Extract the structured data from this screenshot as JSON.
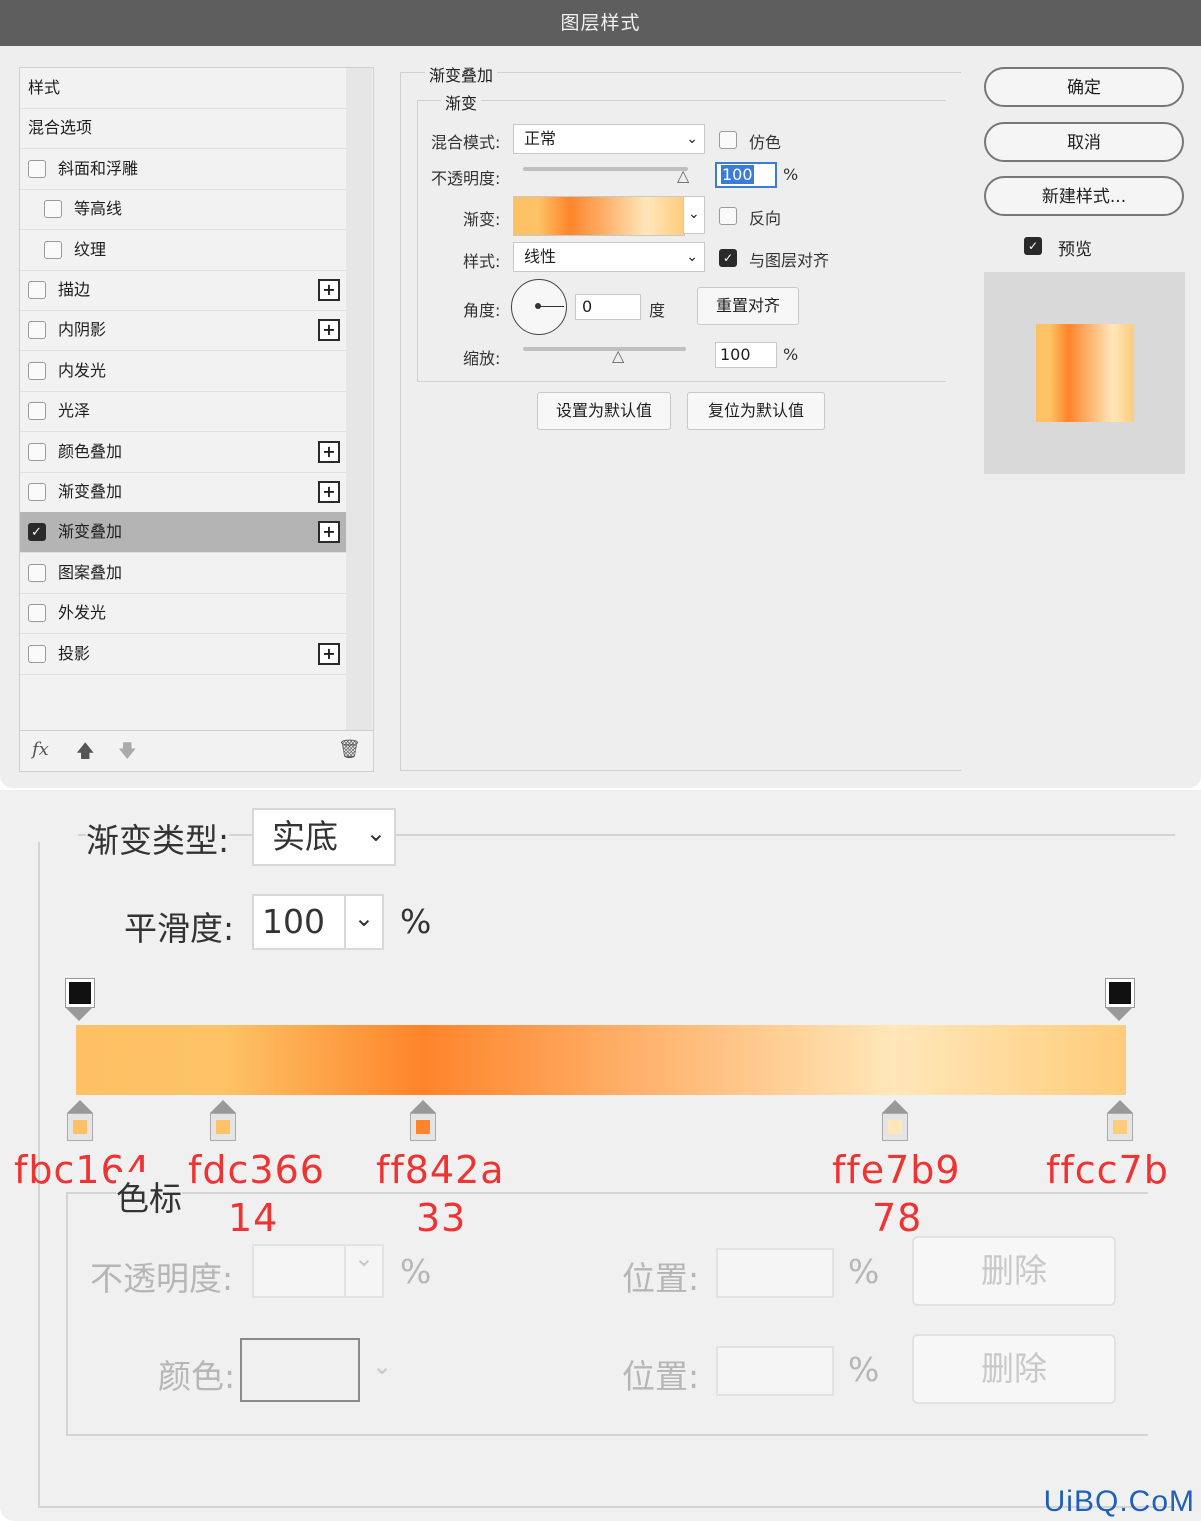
{
  "dialog": {
    "title": "图层样式",
    "list_header": "样式",
    "blend_options": "混合选项",
    "items": [
      {
        "label": "斜面和浮雕",
        "checked": false,
        "plus": false
      },
      {
        "label": "等高线",
        "checked": false,
        "plus": false
      },
      {
        "label": "纹理",
        "checked": false,
        "plus": false
      },
      {
        "label": "描边",
        "checked": false,
        "plus": true
      },
      {
        "label": "内阴影",
        "checked": false,
        "plus": true
      },
      {
        "label": "内发光",
        "checked": false,
        "plus": false
      },
      {
        "label": "光泽",
        "checked": false,
        "plus": false
      },
      {
        "label": "颜色叠加",
        "checked": false,
        "plus": true
      },
      {
        "label": "渐变叠加",
        "checked": false,
        "plus": true
      },
      {
        "label": "渐变叠加",
        "checked": true,
        "plus": true
      },
      {
        "label": "图案叠加",
        "checked": false,
        "plus": false
      },
      {
        "label": "外发光",
        "checked": false,
        "plus": false
      },
      {
        "label": "投影",
        "checked": false,
        "plus": true
      }
    ],
    "footer_fx": "fx"
  },
  "panel": {
    "section_title": "渐变叠加",
    "group_title": "渐变",
    "blend_mode_label": "混合模式:",
    "blend_mode_value": "正常",
    "dither_label": "仿色",
    "opacity_label": "不透明度:",
    "opacity_value": "100",
    "percent": "%",
    "gradient_label": "渐变:",
    "reverse_label": "反向",
    "style_label": "样式:",
    "style_value": "线性",
    "align_label": "与图层对齐",
    "angle_label": "角度:",
    "angle_value": "0",
    "degree_unit": "度",
    "reset_align": "重置对齐",
    "scale_label": "缩放:",
    "scale_value": "100",
    "set_default": "设置为默认值",
    "reset_default": "复位为默认值"
  },
  "actions": {
    "ok": "确定",
    "cancel": "取消",
    "new_style": "新建样式...",
    "preview_label": "预览"
  },
  "gradient_editor": {
    "type_label": "渐变类型:",
    "type_value": "实底",
    "smooth_label": "平滑度:",
    "smooth_value": "100",
    "percent": "%",
    "color_stops_title": "色标",
    "opacity_label": "不透明度:",
    "position_label": "位置:",
    "color_label": "颜色:",
    "delete_label": "删除",
    "stops": [
      {
        "hex": "fbc164",
        "position": "",
        "color": "#fbc164",
        "pos_frac": 0.0
      },
      {
        "hex": "fdc366",
        "position": "14",
        "color": "#fdc366",
        "pos_frac": 0.14
      },
      {
        "hex": "ff842a",
        "position": "33",
        "color": "#ff842a",
        "pos_frac": 0.33
      },
      {
        "hex": "ffe7b9",
        "position": "78",
        "color": "#ffe7b9",
        "pos_frac": 0.78
      },
      {
        "hex": "ffcc7b",
        "position": "",
        "color": "#ffcc7b",
        "pos_frac": 1.0
      }
    ]
  },
  "watermark": "UiBQ.CoM"
}
